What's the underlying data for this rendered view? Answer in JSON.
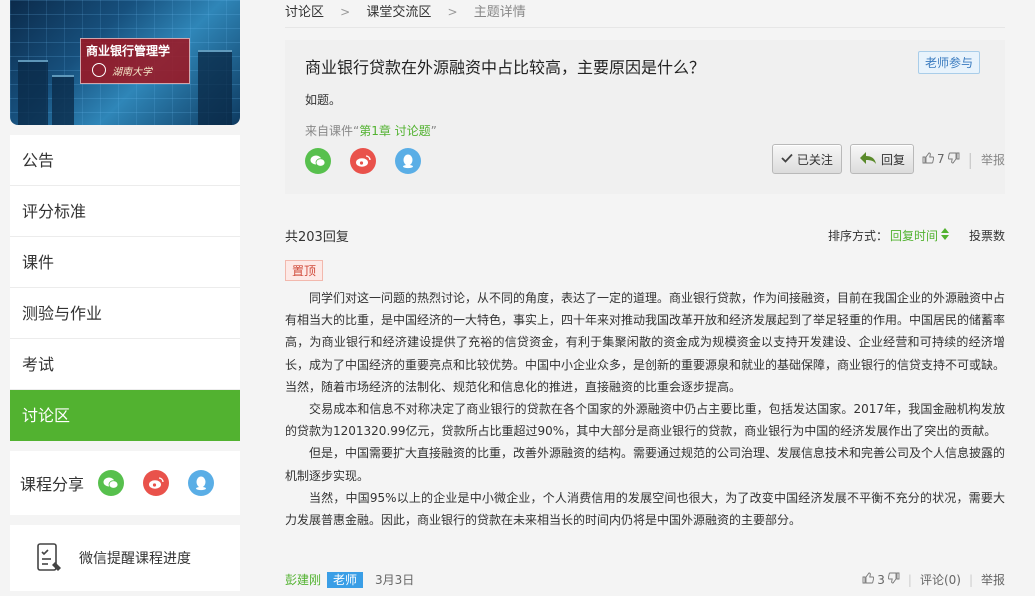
{
  "course": {
    "title": "商业银行管理学",
    "subtitle": "湖南大学"
  },
  "sidebar": {
    "items": [
      {
        "label": "公告"
      },
      {
        "label": "评分标准"
      },
      {
        "label": "课件"
      },
      {
        "label": "测验与作业"
      },
      {
        "label": "考试"
      },
      {
        "label": "讨论区",
        "active": true
      }
    ],
    "share_label": "课程分享",
    "remind_label": "微信提醒课程进度"
  },
  "breadcrumb": {
    "items": [
      "讨论区",
      "课堂交流区",
      "主题详情"
    ]
  },
  "topic": {
    "title": "商业银行贷款在外源融资中占比较高，主要原因是什么？",
    "badge": "老师参与",
    "body": "如题。",
    "source_prefix": "来自课件“",
    "source_link": "第1章 讨论题",
    "source_suffix": "”",
    "follow_label": "已关注",
    "reply_label": "回复",
    "likes": "7",
    "report_label": "举报"
  },
  "replies": {
    "count_label": "共203回复",
    "sort_label": "排序方式：",
    "sort_active": "回复时间",
    "vote_label": "投票数",
    "pinned_label": "置顶",
    "paragraphs": [
      "同学们对这一问题的热烈讨论，从不同的角度，表达了一定的道理。商业银行贷款，作为间接融资，目前在我国企业的外源融资中占有相当大的比重，是中国经济的一大特色，事实上，四十年来对推动我国改革开放和经济发展起到了举足轻重的作用。中国居民的储蓄率高，为商业银行和经济建设提供了充裕的信贷资金，有利于集聚闲散的资金成为规模资金以支持开发建设、企业经营和可持续的经济增长，成为了中国经济的重要亮点和比较优势。中国中小企业众多，是创新的重要源泉和就业的基础保障，商业银行的信贷支持不可或缺。当然，随着市场经济的法制化、规范化和信息化的推进，直接融资的比重会逐步提高。",
      "交易成本和信息不对称决定了商业银行的贷款在各个国家的外源融资中仍占主要比重，包括发达国家。2017年，我国金融机构发放的贷款为1201320.99亿元，贷款所占比重超过90%，其中大部分是商业银行的贷款，商业银行为中国的经济发展作出了突出的贡献。",
      "但是，中国需要扩大直接融资的比重，改善外源融资的结构。需要通过规范的公司治理、发展信息技术和完善公司及个人信息披露的机制逐步实现。",
      "当然，中国95%以上的企业是中小微企业，个人消费信用的发展空间也很大，为了改变中国经济发展不平衡不充分的状况，需要大力发展普惠金融。因此，商业银行的贷款在未来相当长的时间内仍将是中国外源融资的主要部分。"
    ],
    "author": "彭建刚",
    "role": "老师",
    "date": "3月3日",
    "likes": "3",
    "comment_label": "评论(0)",
    "report_label": "举报"
  },
  "colors": {
    "accent": "#52b230",
    "wechat": "#57c04d",
    "weibo": "#e9524b",
    "qq": "#5aaee6"
  },
  "icons": [
    "wechat-icon",
    "weibo-icon",
    "qq-icon",
    "check-icon",
    "reply-arrow-icon",
    "thumb-up-icon",
    "thumb-down-icon",
    "sort-arrows-icon",
    "checklist-icon",
    "chevron-right-icon"
  ]
}
